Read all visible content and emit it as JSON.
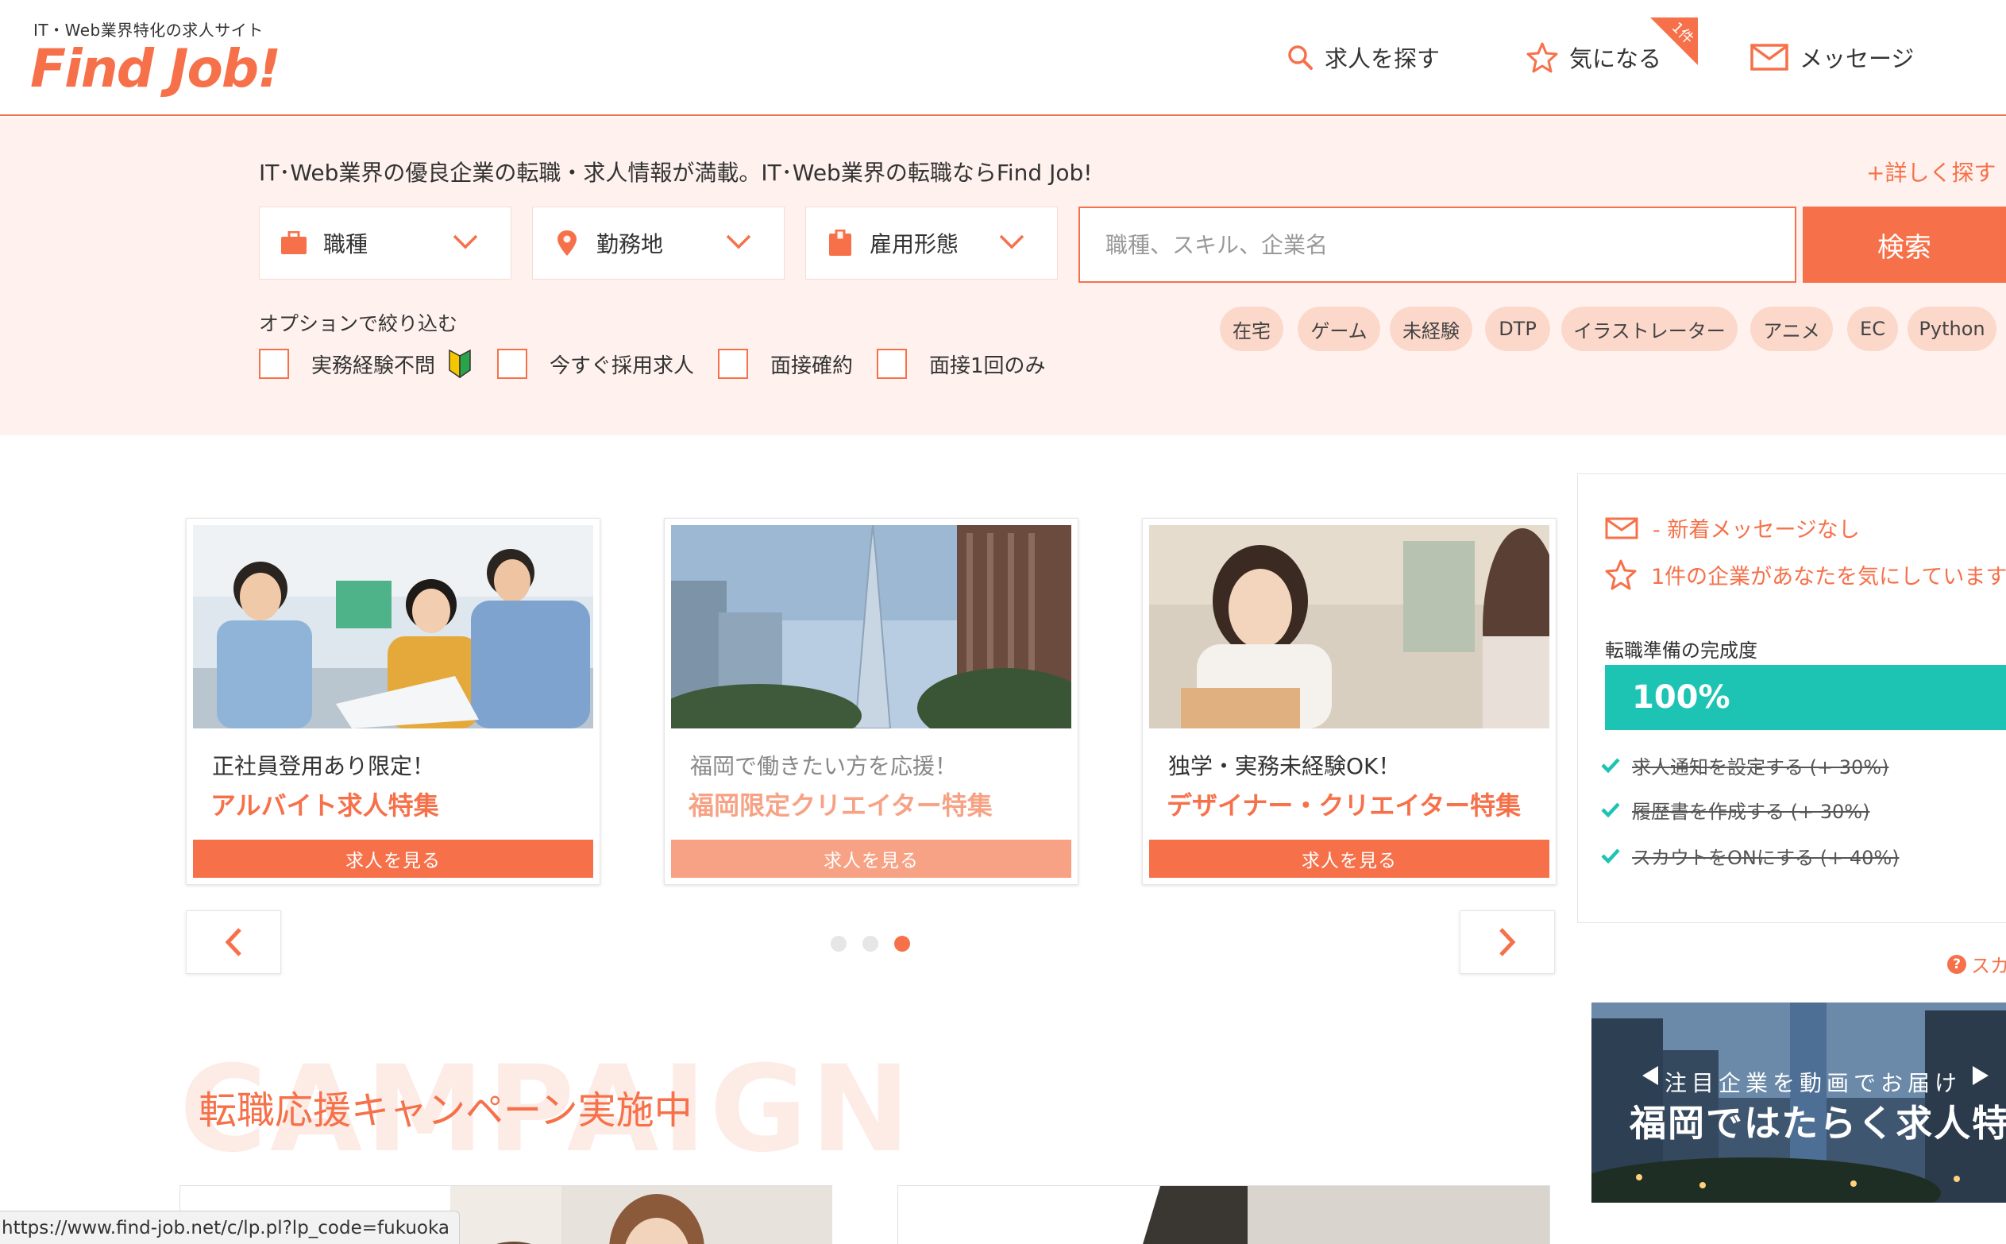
{
  "header": {
    "tagline": "IT・Web業界特化の求人サイト",
    "logo": "Find Job!",
    "nav": {
      "search": "求人を探す",
      "favorite": "気になる",
      "favorite_badge": "1件",
      "message": "メッセージ"
    }
  },
  "search": {
    "lead": "IT･Web業界の優良企業の転職・求人情報が満載。IT･Web業界の転職ならFind Job!",
    "detail_link": "+詳しく探す",
    "selects": {
      "job": "職種",
      "location": "勤務地",
      "employment": "雇用形態"
    },
    "keyword_placeholder": "職種、スキル、企業名",
    "button": "検索",
    "options_label": "オプションで絞り込む",
    "options": [
      "実務経験不問",
      "今すぐ採用求人",
      "面接確約",
      "面接1回のみ"
    ],
    "tags": [
      "在宅",
      "ゲーム",
      "未経験",
      "DTP",
      "イラストレーター",
      "アニメ",
      "EC",
      "Python"
    ]
  },
  "features": {
    "cards": [
      {
        "subtitle": "正社員登用あり限定！",
        "title": "アルバイト求人特集",
        "button": "求人を見る"
      },
      {
        "subtitle": "福岡で働きたい方を応援！",
        "title": "福岡限定クリエイター特集",
        "button": "求人を見る"
      },
      {
        "subtitle": "独学・実務未経験OK！",
        "title": "デザイナー・クリエイター特集",
        "button": "求人を見る"
      }
    ],
    "dots_total": 3,
    "dots_active": 3
  },
  "campaign": {
    "bg_text": "CAMPAIGN",
    "title": "転職応援キャンペーン実施中"
  },
  "side_panel": {
    "message_status": "- 新着メッセージなし",
    "favorited_status": "1件の企業があなたを気にしています",
    "prep_label": "転職準備の完成度",
    "prep_value": "100%",
    "prep_fraction": 1.0,
    "tasks": [
      "求人通知を設定する (+ 30%)",
      "履歴書を作成する (+ 30%)",
      "スカウトをONにする (+ 40%)"
    ],
    "scout_link": "スカ",
    "banner": {
      "line1": "注目企業を動画でお届け",
      "line2": "福岡ではたらく求人特"
    }
  },
  "status_bar": {
    "url": "https://www.find-job.net/c/lp.pl?lp_code=fukuoka"
  },
  "colors": {
    "accent": "#f6714a",
    "accent_light": "#f7a285",
    "band_bg": "#fff2ee",
    "tag_bg": "#fcd8cb",
    "progress": "#1ec4b3"
  }
}
